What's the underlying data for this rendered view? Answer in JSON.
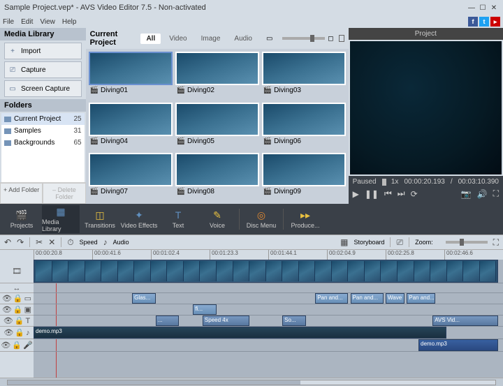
{
  "title": "Sample Project.vep* - AVS Video Editor 7.5 - Non-activated",
  "menu": [
    "File",
    "Edit",
    "View",
    "Help"
  ],
  "left": {
    "hdr": "Media Library",
    "buttons": [
      {
        "label": "Import",
        "icon": "+"
      },
      {
        "label": "Capture",
        "icon": "⎚"
      },
      {
        "label": "Screen Capture",
        "icon": "▭"
      }
    ],
    "foldersHdr": "Folders",
    "folders": [
      {
        "name": "Current Project",
        "count": 25,
        "sel": true
      },
      {
        "name": "Samples",
        "count": 31,
        "sel": false
      },
      {
        "name": "Backgrounds",
        "count": 65,
        "sel": false
      }
    ],
    "addBtn": "+ Add Folder",
    "delBtn": "– Delete Folder"
  },
  "mid": {
    "hdr": "Current Project",
    "tabs": [
      "All",
      "Video",
      "Image",
      "Audio"
    ],
    "thumbs": [
      "Diving01",
      "Diving02",
      "Diving03",
      "Diving04",
      "Diving05",
      "Diving06",
      "Diving07",
      "Diving08",
      "Diving09"
    ]
  },
  "preview": {
    "hdr": "Project",
    "status": "Paused",
    "speed": "1x",
    "cur": "00:00:20.193",
    "dur": "00:03:10.390"
  },
  "toolbar": [
    {
      "label": "Projects",
      "icon": "🎬",
      "cls": ""
    },
    {
      "label": "Media Library",
      "icon": "▦",
      "cls": "blue",
      "active": true
    },
    {
      "label": "Transitions",
      "icon": "◫",
      "cls": "yellow"
    },
    {
      "label": "Video Effects",
      "icon": "✦",
      "cls": "blue"
    },
    {
      "label": "Text",
      "icon": "T",
      "cls": "blue"
    },
    {
      "label": "Voice",
      "icon": "✎",
      "cls": "yellow"
    },
    {
      "label": "Disc Menu",
      "icon": "◎",
      "cls": "orange"
    },
    {
      "label": "Produce...",
      "icon": "▸▸",
      "cls": "yellow"
    }
  ],
  "editbar": {
    "speed": "Speed",
    "audio": "Audio",
    "storyboard": "Storyboard",
    "zoom": "Zoom:"
  },
  "ruler": [
    "00:00:20.8",
    "00:00:41.6",
    "00:01:02.4",
    "00:01:23.3",
    "00:01:44.1",
    "00:02:04.9",
    "00:02:25.8",
    "00:02:46.6"
  ],
  "timeline": {
    "effects": [
      {
        "l": 21,
        "w": 5,
        "t": "Glas..."
      }
    ],
    "pan": [
      {
        "l": 60,
        "w": 7,
        "t": "Pan and..."
      },
      {
        "l": 67.5,
        "w": 7,
        "t": "Pan and..."
      },
      {
        "l": 75,
        "w": 4,
        "t": "Wave"
      },
      {
        "l": 79.5,
        "w": 6,
        "t": "Pan and..."
      }
    ],
    "overlay": [
      {
        "l": 34,
        "w": 5,
        "t": "fi..."
      }
    ],
    "text": [
      {
        "l": 26,
        "w": 5,
        "t": "..."
      },
      {
        "l": 36,
        "w": 10,
        "t": "Speed 4x"
      },
      {
        "l": 53,
        "w": 5,
        "t": "So..."
      },
      {
        "l": 85,
        "w": 14,
        "t": "AVS Vid..."
      }
    ],
    "audio1": {
      "t": "demo.mp3"
    },
    "audio2": {
      "t": "demo.mp3"
    }
  }
}
